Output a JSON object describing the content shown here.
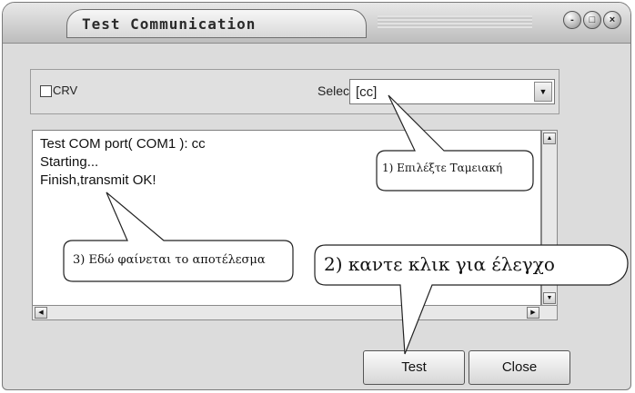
{
  "window": {
    "title": "Test Communication",
    "controls": {
      "minimize": "-",
      "maximize": "□",
      "close": "×"
    }
  },
  "options": {
    "crv_label": "CRV",
    "crv_checked": false,
    "select_label": "Select",
    "select_value": "[cc]"
  },
  "log": {
    "lines": [
      "Test COM port( COM1 ): cc",
      "Starting...",
      "Finish,transmit OK!"
    ]
  },
  "buttons": {
    "test": "Test",
    "close": "Close"
  },
  "annotations": {
    "step1": "1) Επιλέξτε Ταμειακή",
    "step2": "2) καντε κλικ για έλεγχο",
    "step3": "3) Εδώ φαίνεται το αποτέλεσμα"
  },
  "icons": {
    "checkbox": "checkbox-icon",
    "dropdown": "chevron-down-icon",
    "scroll_up": "arrow-up-icon",
    "scroll_down": "arrow-down-icon",
    "scroll_left": "arrow-left-icon",
    "scroll_right": "arrow-right-icon"
  }
}
